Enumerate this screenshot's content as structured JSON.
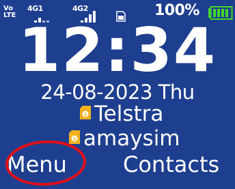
{
  "status_bar": {
    "volte_top": "Vo",
    "volte_bottom": "LTE",
    "sim1_network": "4G1",
    "sim2_network": "4G2",
    "battery_percent": "100%",
    "battery_level": 1.0,
    "icons": [
      "volte-icon",
      "signal-icon",
      "signal-icon",
      "sim-card-icon",
      "battery-icon"
    ]
  },
  "clock": {
    "time": "12:34",
    "date": "24-08-2023 Thu"
  },
  "operators": [
    {
      "sim": "1",
      "name": "Telstra"
    },
    {
      "sim": "2",
      "name": "amaysim"
    }
  ],
  "softkeys": {
    "left": "Menu",
    "right": "Contacts"
  },
  "colors": {
    "background": "#1e3f8f",
    "sim_badge": "#f2b21c",
    "battery": "#44d62c",
    "highlight_circle": "#e0101a"
  }
}
